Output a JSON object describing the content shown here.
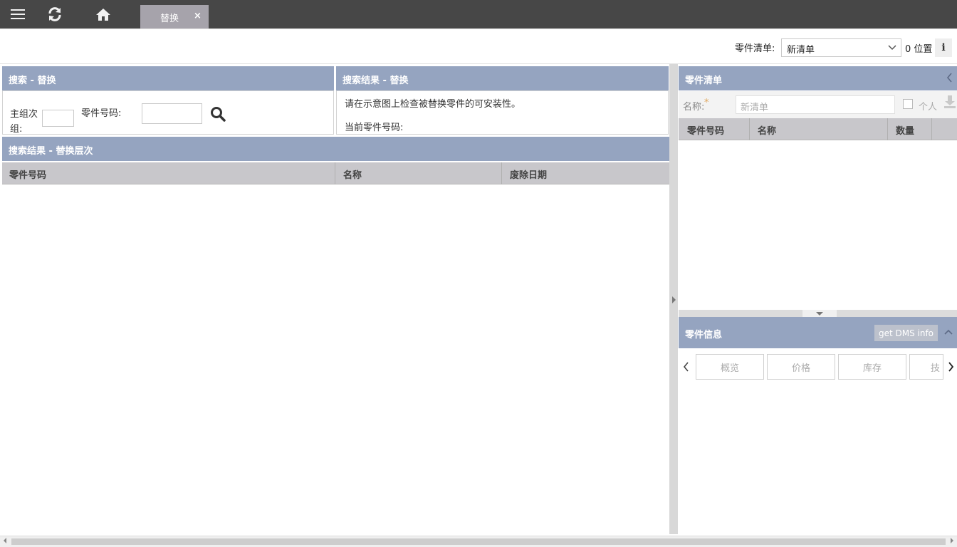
{
  "topbar": {
    "menu_icon": "menu-icon",
    "refresh_icon": "refresh-icon",
    "home_icon": "home-icon",
    "tab_label": "替换",
    "tab_close": "×"
  },
  "toolbar": {
    "list_label": "零件清单:",
    "list_value": "新清单",
    "position_text": "0 位置",
    "info_label": "i"
  },
  "search_panel": {
    "title": "搜索 - 替换",
    "group_label_1": "主组次",
    "group_label_2": "组:",
    "part_label": "零件号码:"
  },
  "result_panel": {
    "title": "搜索结果 - 替换",
    "hint": "请在示意图上检查被替换零件的可安装性。",
    "current_part_label": "当前零件号码:"
  },
  "hierarchy_panel": {
    "title": "搜索结果 - 替换层次",
    "columns": [
      "零件号码",
      "名称",
      "废除日期"
    ]
  },
  "parts_list_panel": {
    "title": "零件清单",
    "name_label": "名称:",
    "required_mark": "*",
    "name_placeholder": "新清单",
    "personal_label": "个人",
    "columns": [
      "零件号码",
      "名称",
      "数量"
    ]
  },
  "part_info_panel": {
    "title": "零件信息",
    "dms_button": "get DMS info",
    "tabs": [
      "概览",
      "价格",
      "库存",
      "技"
    ]
  }
}
